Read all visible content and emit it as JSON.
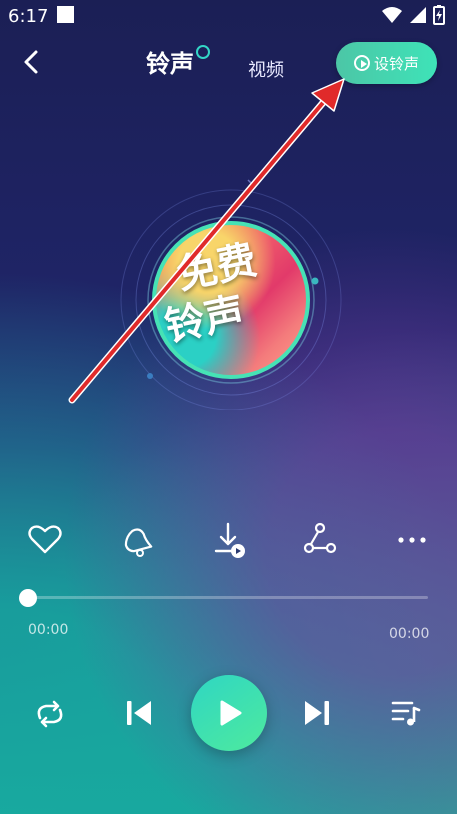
{
  "status_bar": {
    "time": "6:17"
  },
  "header": {
    "tab_ringtone": "铃声",
    "tab_video": "视频",
    "set_ringtone_label": "设铃声"
  },
  "cover": {
    "line1": "免费",
    "line2": "铃声"
  },
  "player": {
    "time_current": "00:00",
    "time_total": "00:00",
    "progress": 0
  },
  "colors": {
    "accent": "#3ee3b8",
    "arrow": "#e02a2a"
  },
  "icons": {
    "actions": [
      "heart-icon",
      "bell-icon",
      "download-icon",
      "share-icon",
      "more-icon"
    ],
    "controls": [
      "repeat-icon",
      "previous-icon",
      "play-icon",
      "next-icon",
      "playlist-icon"
    ]
  }
}
